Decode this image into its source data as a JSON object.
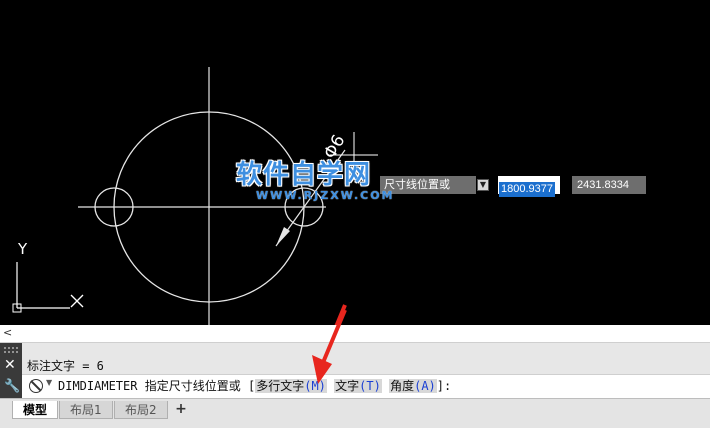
{
  "canvas": {
    "axis_label_y": "Y",
    "dimension_text": "Φ6",
    "dynamic_input": {
      "prompt_text": "尺寸线位置或",
      "value_selected": "1800.9377",
      "value_second": "2431.8334"
    }
  },
  "watermark": {
    "title": "软件自学网",
    "url": "WWW.RJZXW.COM"
  },
  "command": {
    "history_line": "标注文字 = 6",
    "command_name": "DIMDIAMETER",
    "prompt": "指定尺寸线位置或",
    "options_open": "[",
    "option1_label": "多行文字",
    "option1_key": "(M)",
    "option2_label": "文字",
    "option2_key": "(T)",
    "option3_label": "角度",
    "option3_key": "(A)",
    "options_close": "]:"
  },
  "tabs": {
    "model": "模型",
    "layout1": "布局1",
    "layout2": "布局2",
    "add": "+"
  },
  "colors": {
    "canvas_bg": "#000000",
    "watermark": "#3e8fe0",
    "selection": "#1b6fce",
    "annotation_arrow": "#e8261e"
  }
}
